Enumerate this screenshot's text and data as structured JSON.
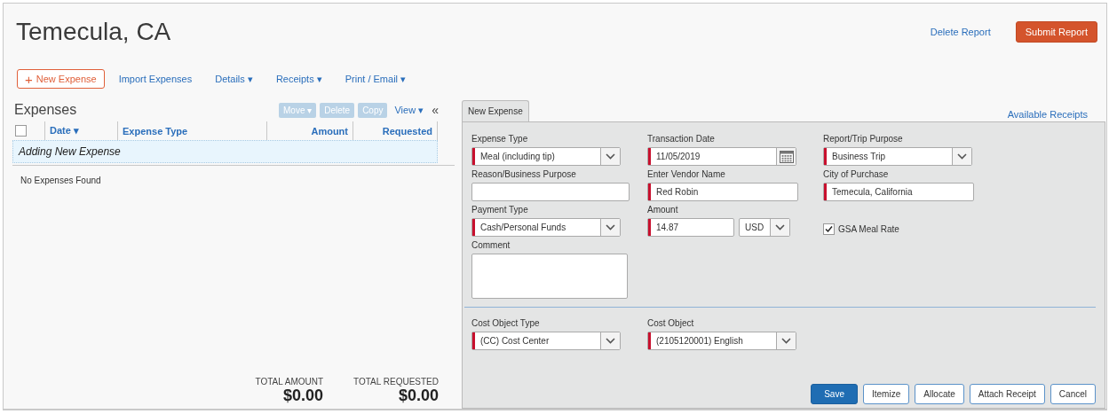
{
  "title": "Temecula, CA",
  "header_actions": {
    "delete_link": "Delete Report",
    "submit_button": "Submit Report"
  },
  "toolbar": {
    "new_expense": {
      "icon": "+",
      "label": "New Expense"
    },
    "items": [
      {
        "label": "Import Expenses"
      },
      {
        "label": "Details",
        "caret": "▾"
      },
      {
        "label": "Receipts",
        "caret": "▾"
      },
      {
        "label": "Print / Email",
        "caret": "▾"
      }
    ]
  },
  "expenses": {
    "title": "Expenses",
    "buttons": [
      {
        "label": "Move",
        "caret": "▾",
        "disabled": true
      },
      {
        "label": "Delete",
        "disabled": true
      },
      {
        "label": "Copy",
        "disabled": true
      }
    ],
    "view": {
      "label": "View",
      "caret": "▾"
    },
    "collapse": "«",
    "select_all_checked": false,
    "columns": [
      {
        "label": "Date",
        "sort": "▾",
        "kind": "text"
      },
      {
        "label": "Expense Type",
        "kind": "text"
      },
      {
        "label": "Amount",
        "kind": "number"
      },
      {
        "label": "Requested",
        "kind": "number"
      }
    ],
    "adding_row": "Adding New Expense",
    "empty_message": "No Expenses Found",
    "totals": [
      {
        "label": "TOTAL AMOUNT",
        "value": "$0.00"
      },
      {
        "label": "TOTAL REQUESTED",
        "value": "$0.00"
      }
    ]
  },
  "form": {
    "tabs": [
      {
        "label": "New Expense",
        "selected": true
      }
    ],
    "available_receipts": "Available Receipts",
    "rows": [
      [
        {
          "kind": "select",
          "label": "Expense Type",
          "value": "Meal (including tip)",
          "required": true
        },
        {
          "kind": "date",
          "label": "Transaction Date",
          "value": "11/05/2019",
          "required": true
        },
        {
          "kind": "select",
          "label": "Report/Trip Purpose",
          "value": "Business Trip",
          "required": true
        }
      ],
      [
        {
          "kind": "text",
          "label": "Reason/Business Purpose",
          "required": false
        },
        {
          "kind": "text",
          "label": "Enter Vendor Name",
          "value": "Red Robin",
          "required": true
        },
        {
          "kind": "text",
          "label": "City of Purchase",
          "value": "Temecula, California",
          "required": true
        }
      ],
      [
        {
          "kind": "select",
          "label": "Payment Type",
          "value": "Cash/Personal Funds",
          "required": true
        },
        {
          "kind": "amount",
          "label": "Amount",
          "value": "14.87",
          "currency": "USD",
          "required": true
        },
        {
          "kind": "checkbox",
          "label": "GSA Meal Rate",
          "checked": true
        }
      ],
      [
        {
          "kind": "textarea",
          "label": "Comment",
          "required": false
        }
      ]
    ],
    "cost_rows": [
      [
        {
          "kind": "select",
          "label": "Cost Object Type",
          "value": "(CC) Cost Center",
          "required": true
        },
        {
          "kind": "select",
          "label": "Cost Object",
          "value": "(2105120001) English",
          "required": true
        }
      ]
    ],
    "buttons": [
      {
        "label": "Save",
        "kind": "primary"
      },
      {
        "label": "Itemize",
        "kind": "secondary"
      },
      {
        "label": "Allocate",
        "kind": "secondary"
      },
      {
        "label": "Attach Receipt",
        "kind": "secondary"
      },
      {
        "label": "Cancel",
        "kind": "secondary"
      }
    ]
  }
}
